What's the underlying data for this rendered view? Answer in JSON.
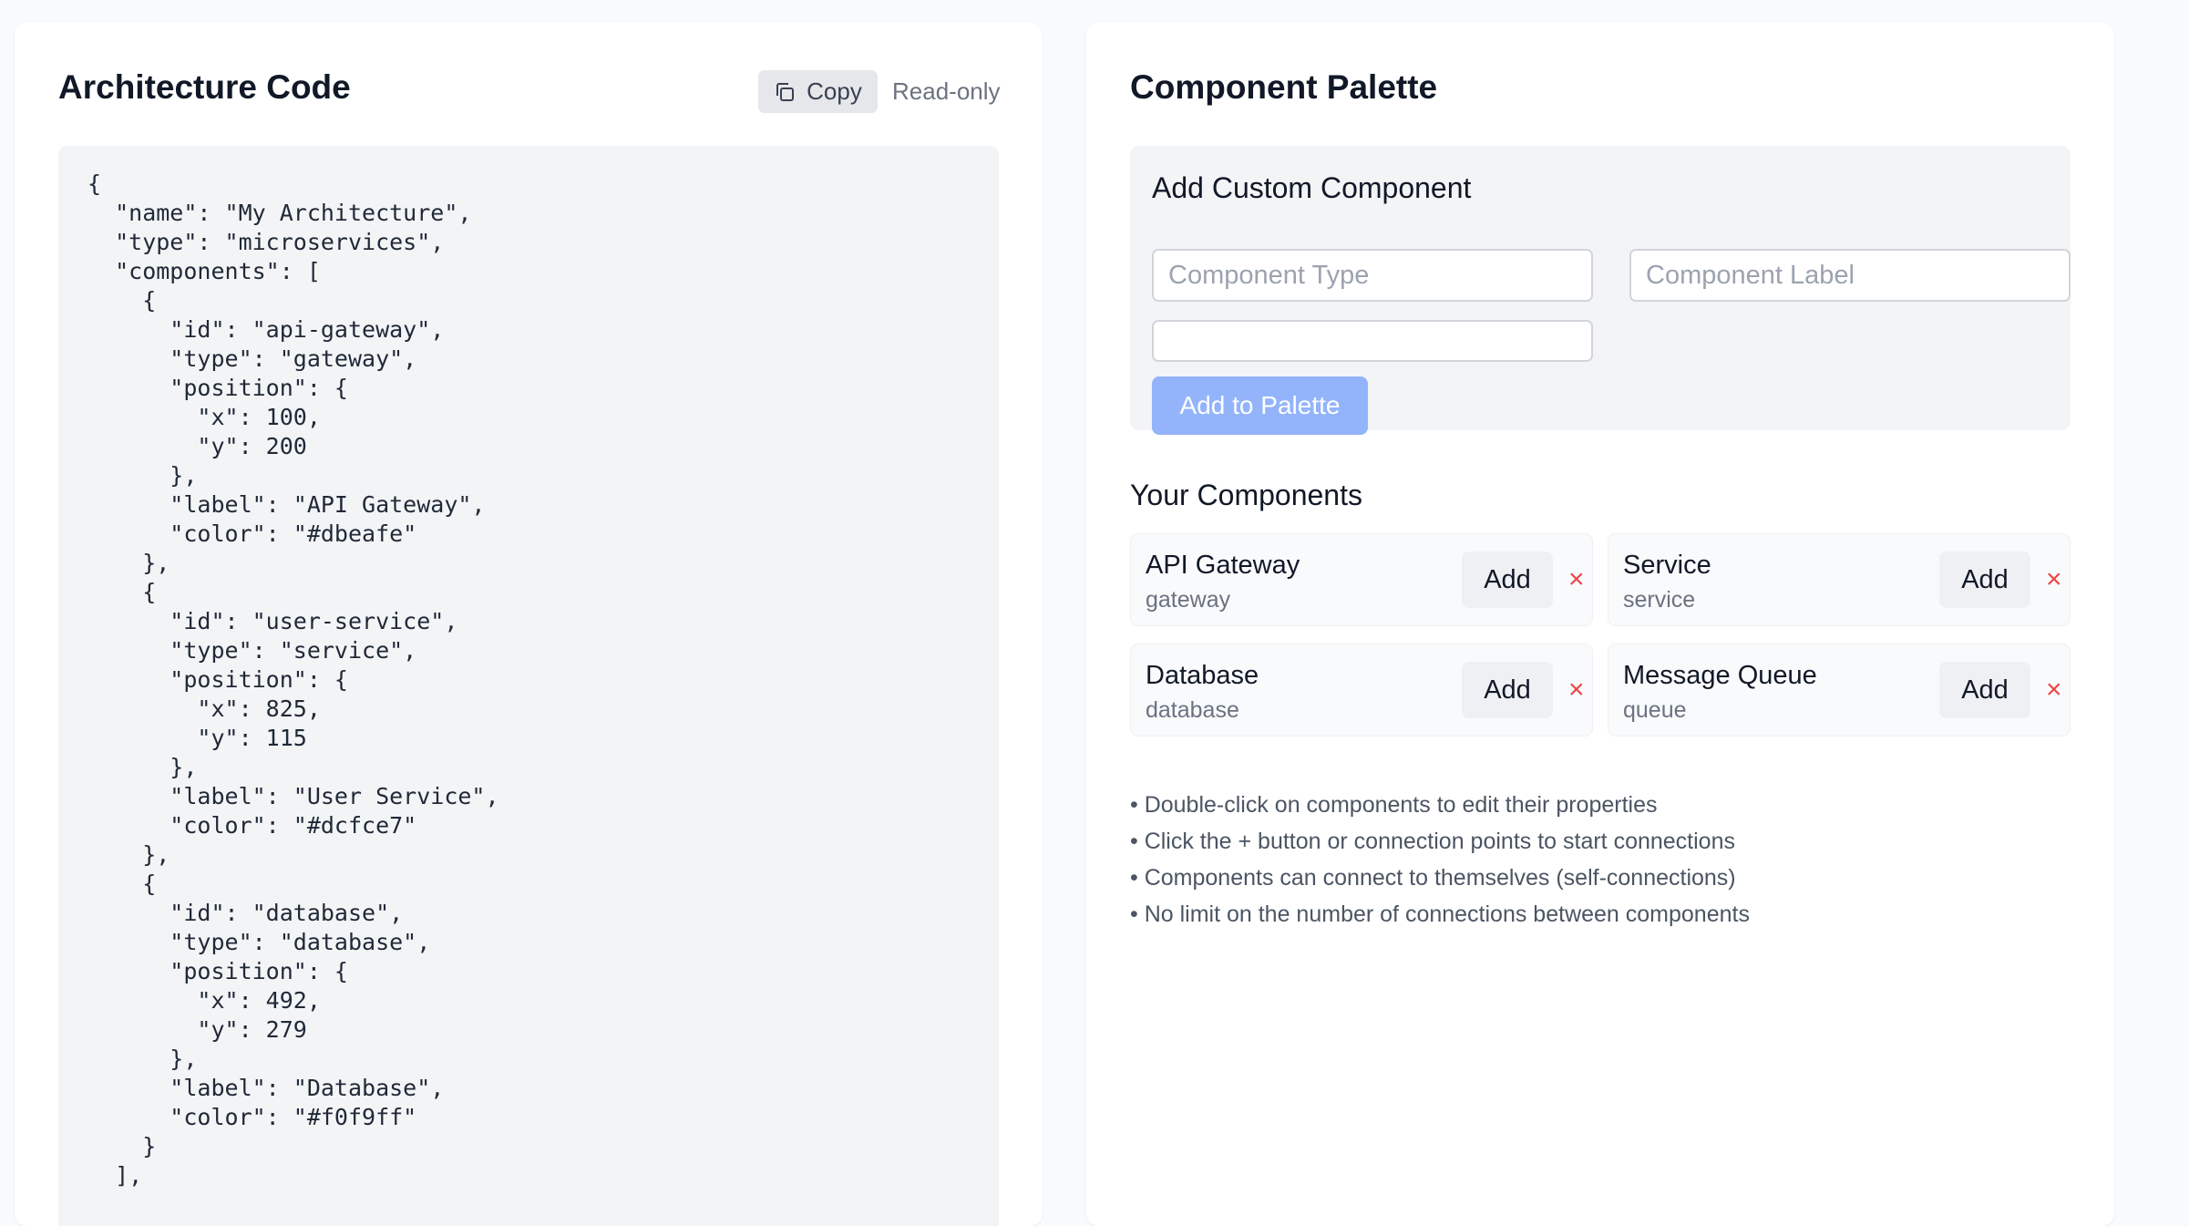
{
  "code_panel": {
    "title": "Architecture Code",
    "copy_label": "Copy",
    "readonly_label": "Read-only",
    "code": "{\n  \"name\": \"My Architecture\",\n  \"type\": \"microservices\",\n  \"components\": [\n    {\n      \"id\": \"api-gateway\",\n      \"type\": \"gateway\",\n      \"position\": {\n        \"x\": 100,\n        \"y\": 200\n      },\n      \"label\": \"API Gateway\",\n      \"color\": \"#dbeafe\"\n    },\n    {\n      \"id\": \"user-service\",\n      \"type\": \"service\",\n      \"position\": {\n        \"x\": 825,\n        \"y\": 115\n      },\n      \"label\": \"User Service\",\n      \"color\": \"#dcfce7\"\n    },\n    {\n      \"id\": \"database\",\n      \"type\": \"database\",\n      \"position\": {\n        \"x\": 492,\n        \"y\": 279\n      },\n      \"label\": \"Database\",\n      \"color\": \"#f0f9ff\"\n    }\n  ],"
  },
  "palette_panel": {
    "title": "Component Palette",
    "custom": {
      "title": "Add Custom Component",
      "type_placeholder": "Component Type",
      "label_placeholder": "Component Label",
      "color_value": "",
      "add_button": "Add to Palette"
    },
    "your_components": {
      "title": "Your Components",
      "add_label": "Add",
      "remove_glyph": "×",
      "items": [
        {
          "label": "API Gateway",
          "type": "gateway"
        },
        {
          "label": "Service",
          "type": "service"
        },
        {
          "label": "Database",
          "type": "database"
        },
        {
          "label": "Message Queue",
          "type": "queue"
        }
      ]
    },
    "tips": [
      "• Double-click on components to edit their properties",
      "• Click the + button or connection points to start connections",
      "• Components can connect to themselves (self-connections)",
      "• No limit on the number of connections between components"
    ]
  },
  "colors": {
    "page_background": "#f8fafc",
    "panel_background": "#ffffff",
    "code_background": "#f3f4f6",
    "primary_disabled": "#93b4fb",
    "remove": "#ef4444"
  },
  "icons": {
    "copy": "copy-icon",
    "remove": "close-icon"
  }
}
